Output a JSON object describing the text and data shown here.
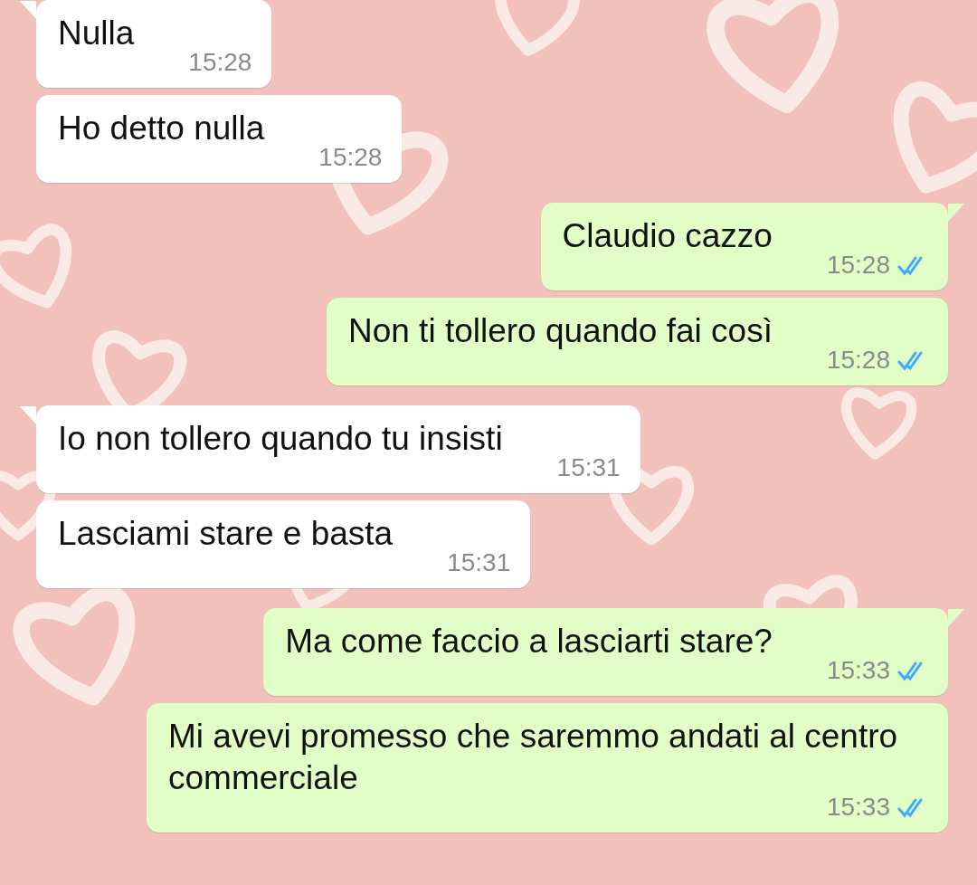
{
  "messages": [
    {
      "kind": "incoming",
      "tail": true,
      "text": "Nulla",
      "time": "15:28"
    },
    {
      "kind": "incoming",
      "tail": false,
      "text": "Ho detto nulla",
      "time": "15:28"
    },
    {
      "kind": "outgoing",
      "tail": true,
      "text": "Claudio cazzo",
      "time": "15:28",
      "read": true
    },
    {
      "kind": "outgoing",
      "tail": false,
      "text": "Non ti tollero quando fai così",
      "time": "15:28",
      "read": true
    },
    {
      "kind": "incoming",
      "tail": true,
      "text": "Io non tollero quando tu insisti",
      "time": "15:31"
    },
    {
      "kind": "incoming",
      "tail": false,
      "text": "Lasciami stare e basta",
      "time": "15:31"
    },
    {
      "kind": "outgoing",
      "tail": true,
      "text": "Ma come faccio a lasciarti stare?",
      "time": "15:33",
      "read": true
    },
    {
      "kind": "outgoing",
      "tail": false,
      "text": "Mi avevi promesso che saremmo andati al centro commerciale",
      "time": "15:33",
      "read": true
    }
  ]
}
